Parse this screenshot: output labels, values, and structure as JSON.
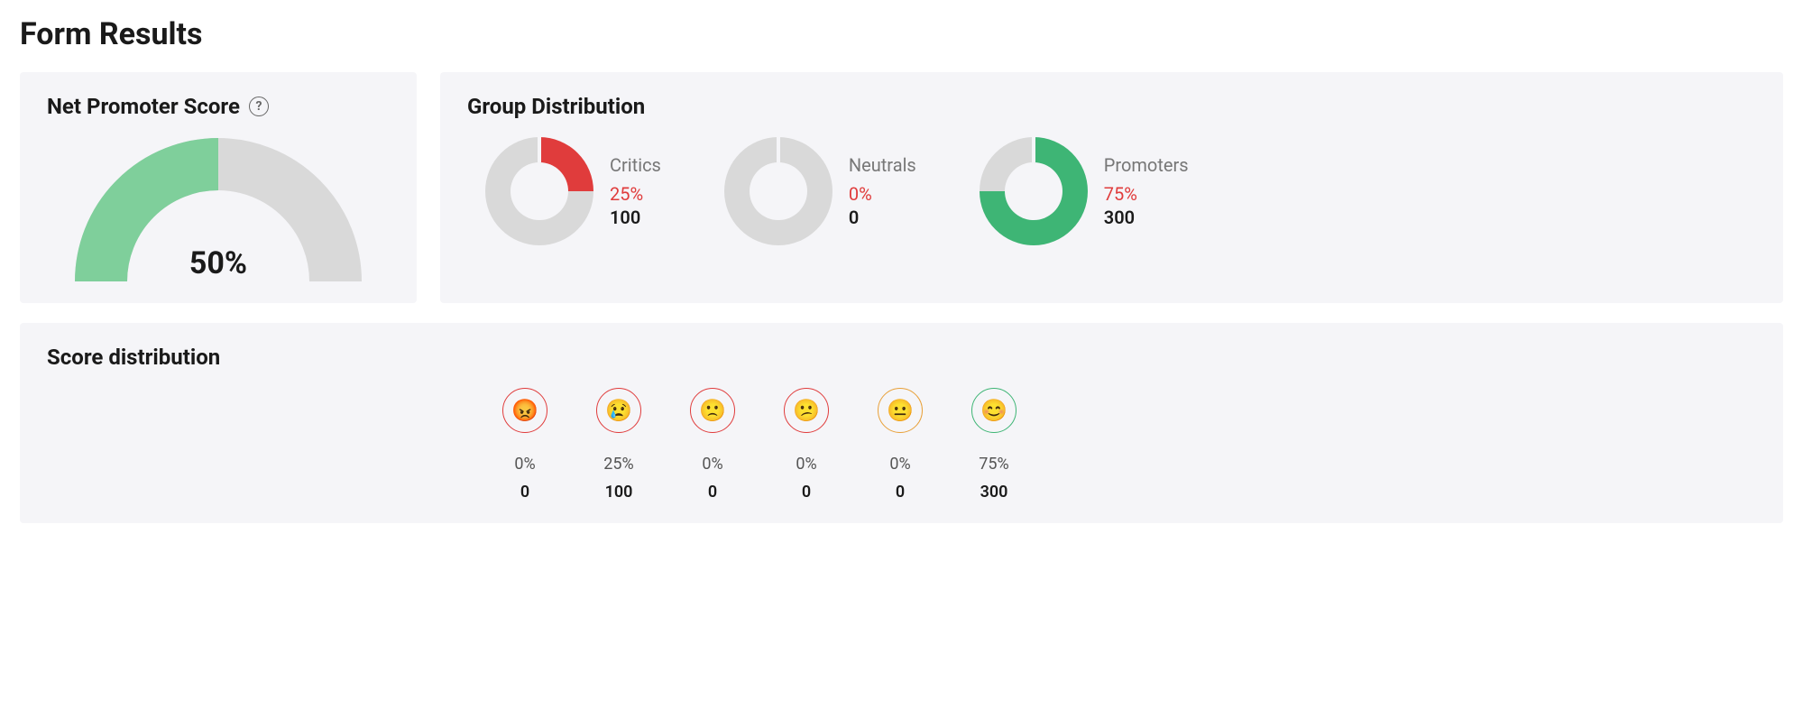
{
  "page_title": "Form Results",
  "nps": {
    "title": "Net Promoter Score",
    "value_pct": 50,
    "value_label": "50%"
  },
  "group_distribution": {
    "title": "Group Distribution",
    "groups": [
      {
        "name": "Critics",
        "pct": 25,
        "pct_label": "25%",
        "count": 100,
        "color": "#e03c3c"
      },
      {
        "name": "Neutrals",
        "pct": 0,
        "pct_label": "0%",
        "count": 0,
        "color": "#d9d9d9"
      },
      {
        "name": "Promoters",
        "pct": 75,
        "pct_label": "75%",
        "count": 300,
        "color": "#3eb575"
      }
    ]
  },
  "score_distribution": {
    "title": "Score distribution",
    "items": [
      {
        "emoji": "😡",
        "ring": "#e03c3c",
        "pct_label": "0%",
        "count": 0
      },
      {
        "emoji": "😢",
        "ring": "#e03c3c",
        "pct_label": "25%",
        "count": 100
      },
      {
        "emoji": "🙁",
        "ring": "#e03c3c",
        "pct_label": "0%",
        "count": 0
      },
      {
        "emoji": "😕",
        "ring": "#e03c3c",
        "pct_label": "0%",
        "count": 0
      },
      {
        "emoji": "😐",
        "ring": "#e8a13a",
        "pct_label": "0%",
        "count": 0
      },
      {
        "emoji": "😊",
        "ring": "#3eb575",
        "pct_label": "75%",
        "count": 300
      }
    ]
  },
  "chart_data": [
    {
      "type": "pie",
      "title": "Net Promoter Score",
      "value": 50,
      "max": 100,
      "display": "semicircle-gauge",
      "colors": {
        "fill": "#3eb575",
        "track": "#d9d9d9"
      }
    },
    {
      "type": "pie",
      "title": "Group Distribution",
      "series": [
        {
          "name": "Critics",
          "value": 25,
          "count": 100,
          "color": "#e03c3c"
        },
        {
          "name": "Neutrals",
          "value": 0,
          "count": 0,
          "color": "#d9d9d9"
        },
        {
          "name": "Promoters",
          "value": 75,
          "count": 300,
          "color": "#3eb575"
        }
      ],
      "display": "three-donuts"
    },
    {
      "type": "bar",
      "title": "Score distribution",
      "categories": [
        "😡",
        "😢",
        "🙁",
        "😕",
        "😐",
        "😊"
      ],
      "values_pct": [
        0,
        25,
        0,
        0,
        0,
        75
      ],
      "counts": [
        0,
        100,
        0,
        0,
        0,
        300
      ],
      "ring_colors": [
        "#e03c3c",
        "#e03c3c",
        "#e03c3c",
        "#e03c3c",
        "#e8a13a",
        "#3eb575"
      ]
    }
  ]
}
